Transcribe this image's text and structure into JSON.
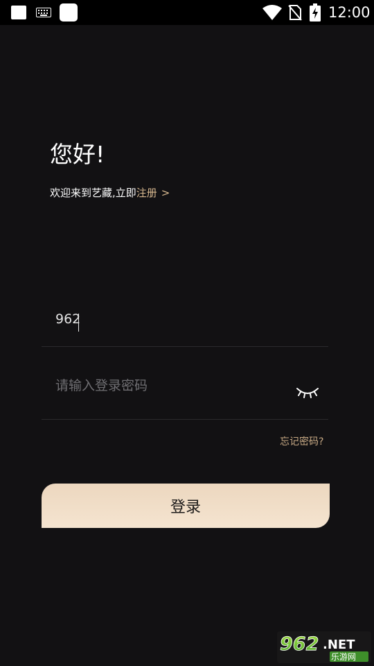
{
  "status_bar": {
    "time": "12:00",
    "icons": [
      "notification-square-icon",
      "keyboard-icon",
      "app-square-icon",
      "wifi-icon",
      "no-sim-icon",
      "battery-charging-icon"
    ]
  },
  "greeting": {
    "title": "您好!",
    "welcome_text": "欢迎来到艺藏,立即",
    "register_link": "注册",
    "register_arrow": ">"
  },
  "form": {
    "username_value": "962",
    "password_placeholder": "请输入登录密码",
    "password_toggle_icon": "eye-closed-icon",
    "forgot_password": "忘记密码?",
    "login_button": "登录"
  },
  "watermark": {
    "brand": "962",
    "suffix": ".NET",
    "subtitle": "乐游网"
  },
  "colors": {
    "background": "#121113",
    "accent_gold": "#d8b990",
    "button_gradient_top": "#ecd7bf",
    "button_gradient_bottom": "#f5e4d0"
  }
}
